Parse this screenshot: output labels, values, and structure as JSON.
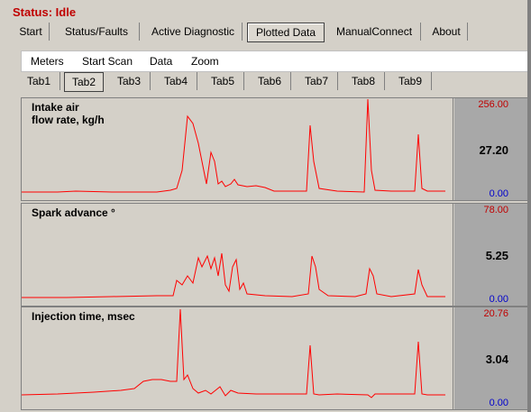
{
  "status": "Status: Idle",
  "main_tabs": [
    {
      "label": "Start"
    },
    {
      "label": "Status/Faults"
    },
    {
      "label": "Active Diagnostic"
    },
    {
      "label": "Plotted Data"
    },
    {
      "label": "ManualConnect"
    },
    {
      "label": "About"
    }
  ],
  "active_main_tab": "Plotted Data",
  "menu": [
    "Meters",
    "Start Scan",
    "Data",
    "Zoom"
  ],
  "sub_tabs": [
    "Tab1",
    "Tab2",
    "Tab3",
    "Tab4",
    "Tab5",
    "Tab6",
    "Tab7",
    "Tab8",
    "Tab9"
  ],
  "active_sub_tab": "Tab2",
  "colors": {
    "trace": "#ff0000",
    "max": "#c00000",
    "min": "#0000cc",
    "status": "#c00000"
  },
  "panels": [
    {
      "label": "Intake air\nflow rate, kg/h",
      "max": "256.00",
      "current": "27.20",
      "min": "0.00"
    },
    {
      "label": "Spark advance °",
      "max": "78.00",
      "current": "5.25",
      "min": "0.00"
    },
    {
      "label": "Injection time, msec",
      "max": "20.76",
      "current": "3.04",
      "min": "0.00"
    }
  ]
}
